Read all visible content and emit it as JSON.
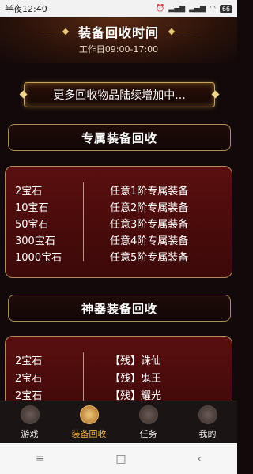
{
  "status": {
    "time": "半夜12:40",
    "signal": "📶",
    "battery": "66"
  },
  "header": {
    "title": "装备回收时间",
    "subtitle": "工作日09:00-17:00"
  },
  "banner": {
    "text": "更多回收物品陆续增加中..."
  },
  "sections": [
    {
      "title": "专属装备回收",
      "rows": [
        {
          "cost": "2宝石",
          "item": "任意1阶专属装备"
        },
        {
          "cost": "10宝石",
          "item": "任意2阶专属装备"
        },
        {
          "cost": "50宝石",
          "item": "任意3阶专属装备"
        },
        {
          "cost": "300宝石",
          "item": "任意4阶专属装备"
        },
        {
          "cost": "1000宝石",
          "item": "任意5阶专属装备"
        }
      ]
    },
    {
      "title": "神器装备回收",
      "rows": [
        {
          "cost": "2宝石",
          "item": "【残】诛仙"
        },
        {
          "cost": "2宝石",
          "item": "【残】鬼王"
        },
        {
          "cost": "2宝石",
          "item": "【残】耀光"
        }
      ]
    }
  ],
  "nav": [
    {
      "label": "游戏",
      "icon": "game-icon",
      "active": false
    },
    {
      "label": "装备回收",
      "icon": "equipment-recycle-icon",
      "active": true
    },
    {
      "label": "任务",
      "icon": "task-icon",
      "active": false
    },
    {
      "label": "我的",
      "icon": "profile-icon",
      "active": false
    }
  ],
  "system_nav": {
    "menu": "≡",
    "home": "□",
    "back": "‹"
  }
}
